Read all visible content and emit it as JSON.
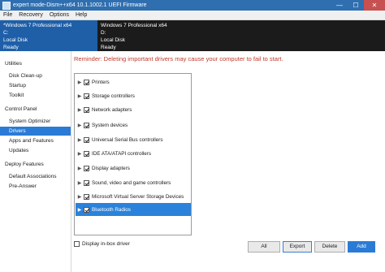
{
  "window": {
    "title": "expert mode-Dism++x64 10.1.1002.1 UEFI Firmware",
    "controls": {
      "minimize": "—",
      "maximize": "☐",
      "close": "✕"
    }
  },
  "menu": [
    "File",
    "Recovery",
    "Options",
    "Help"
  ],
  "images": [
    {
      "name": "*Windows 7 Professional x64",
      "drive": "C:",
      "disk": "Local Disk",
      "status": "Ready"
    },
    {
      "name": "Windows 7 Professional x64",
      "drive": "D:",
      "disk": "Local Disk",
      "status": "Ready"
    }
  ],
  "sidebar": {
    "utilities": "Utilities",
    "disk_cleanup": "Disk Clean-up",
    "startup": "Startup",
    "toolkit": "Toolkit",
    "control_panel": "Control Panel",
    "system_optimizer": "System Optimizer",
    "drivers": "Drivers",
    "apps_features": "Apps and Features",
    "updates": "Updates",
    "deploy_features": "Deploy Features",
    "default_associations": "Default Associations",
    "pre_answer": "Pre-Answer"
  },
  "reminder": "Reminder: Deleting important drivers may cause your computer to fail to start.",
  "drivers": [
    "Printers",
    "Storage controllers",
    "Network adapters",
    "System devices",
    "Universal Serial Bus controllers",
    "IDE ATA/ATAPI controllers",
    "Display adapters",
    "Sound, video and game controllers",
    "Microsoft Virtual Server Storage Devices",
    "Bluetooth Radios"
  ],
  "selected_driver": "Bluetooth Radios",
  "display_inbox_label": "Display in-box driver",
  "buttons": {
    "all": "All",
    "export": "Export",
    "delete": "Delete",
    "add": "Add"
  },
  "colors": {
    "accent": "#2a7bd6",
    "reminder": "#c0392b",
    "image_bar": "#1b1b1b"
  }
}
